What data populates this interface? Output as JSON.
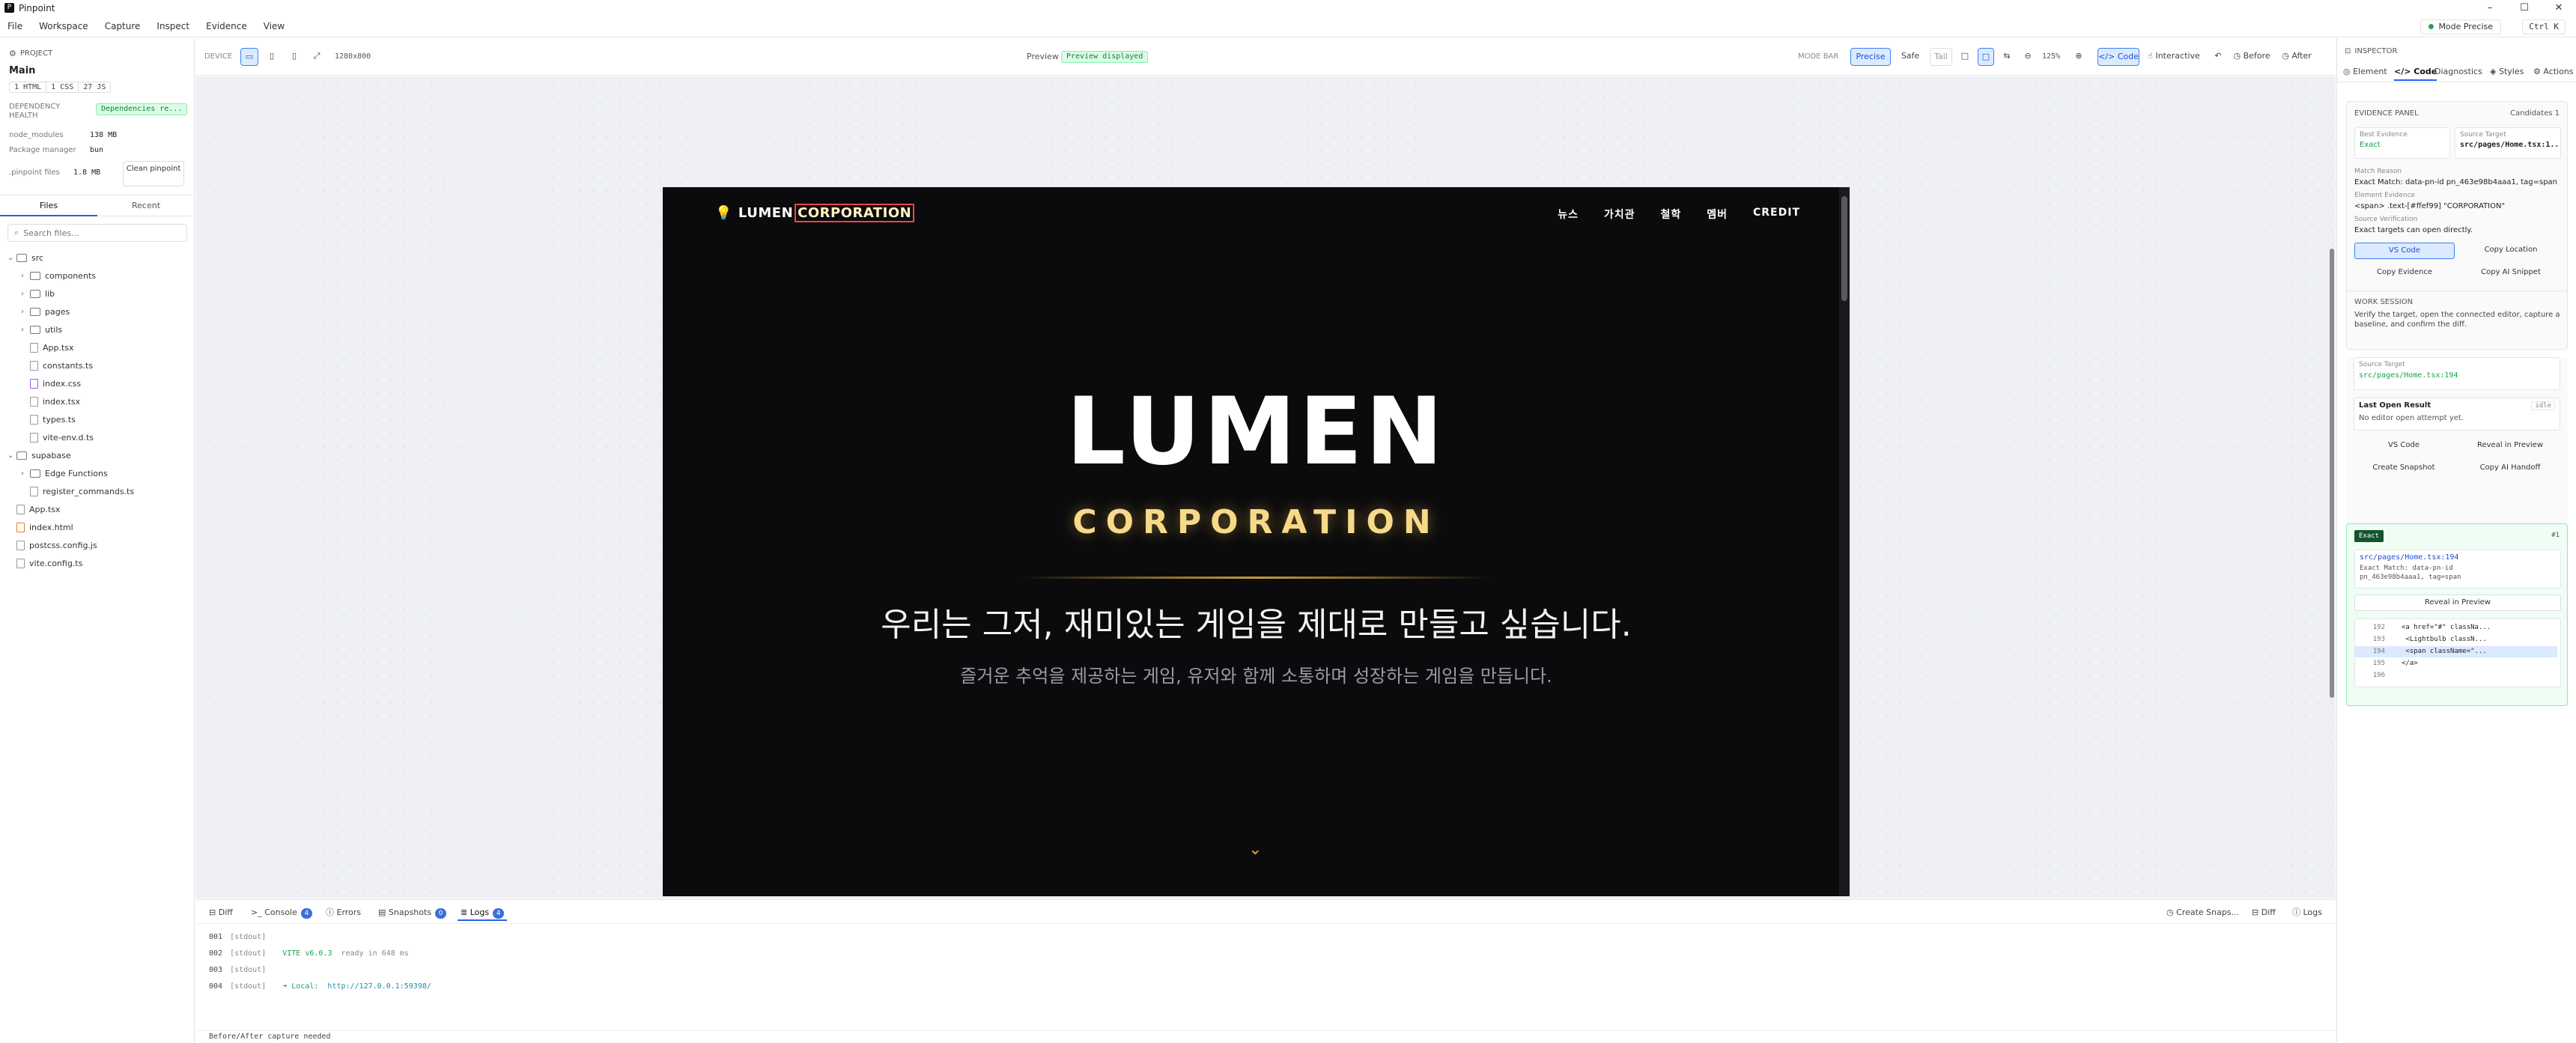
{
  "titlebar": {
    "app_name": "Pinpoint",
    "minimize": "–",
    "maximize": "☐",
    "close": "✕"
  },
  "menu": {
    "items": [
      "File",
      "Workspace",
      "Capture",
      "Inspect",
      "Evidence",
      "View"
    ]
  },
  "mode_pill": {
    "label": "Mode Precise"
  },
  "shortcut": {
    "label": "Ctrl K"
  },
  "project": {
    "header": "PROJECT",
    "name": "Main",
    "chips": [
      "1 HTML",
      "1 CSS",
      "27 JS"
    ],
    "dependency_label": "DEPENDENCY HEALTH",
    "dependency_status": "Dependencies re...",
    "node_modules_label": "node_modules",
    "node_modules_value": "138 MB",
    "package_manager_label": "Package manager",
    "package_manager_value": "bun",
    "pinpoint_files_label": ".pinpoint files",
    "pinpoint_files_value": "1.8 MB",
    "clean_button": "Clean pinpoint"
  },
  "file_tabs": {
    "files": "Files",
    "recent": "Recent"
  },
  "search": {
    "placeholder": "Search files..."
  },
  "tree": [
    {
      "name": "src",
      "type": "folder",
      "level": 0,
      "open": true
    },
    {
      "name": "components",
      "type": "folder",
      "level": 1,
      "open": false
    },
    {
      "name": "lib",
      "type": "folder",
      "level": 1,
      "open": false
    },
    {
      "name": "pages",
      "type": "folder",
      "level": 1,
      "open": false
    },
    {
      "name": "utils",
      "type": "folder",
      "level": 1,
      "open": false
    },
    {
      "name": "App.tsx",
      "type": "file",
      "level": 1
    },
    {
      "name": "constants.ts",
      "type": "file",
      "level": 1
    },
    {
      "name": "index.css",
      "type": "css",
      "level": 1
    },
    {
      "name": "index.tsx",
      "type": "file",
      "level": 1
    },
    {
      "name": "types.ts",
      "type": "file",
      "level": 1
    },
    {
      "name": "vite-env.d.ts",
      "type": "file",
      "level": 1
    },
    {
      "name": "supabase",
      "type": "folder",
      "level": 0,
      "open": true
    },
    {
      "name": "Edge Functions",
      "type": "folder",
      "level": 1,
      "open": false
    },
    {
      "name": "register_commands.ts",
      "type": "file",
      "level": 1
    },
    {
      "name": "App.tsx",
      "type": "file",
      "level": 0
    },
    {
      "name": "index.html",
      "type": "html",
      "level": 0
    },
    {
      "name": "postcss.config.js",
      "type": "file",
      "level": 0
    },
    {
      "name": "vite.config.ts",
      "type": "file",
      "level": 0
    }
  ],
  "toolbar": {
    "device_label": "DEVICE",
    "resolution": "1280x800",
    "preview_label": "Preview",
    "preview_status": "Preview displayed",
    "mode_bar_label": "MODE BAR",
    "precise": "Precise",
    "safe": "Safe",
    "tail": "Tail",
    "zoom": "125%",
    "code": "Code",
    "interactive": "Interactive",
    "before": "Before",
    "after": "After"
  },
  "site": {
    "brand_a": "LUMEN",
    "brand_b": "CORPORATION",
    "nav": [
      "뉴스",
      "가치관",
      "철학",
      "멤버",
      "CREDIT"
    ],
    "hero_title": "LUMEN",
    "hero_subtitle": "CORPORATION",
    "tagline": "우리는 그저, 재미있는 게임을 제대로 만들고 싶습니다.",
    "subtagline": "즐거운 추억을 제공하는 게임, 유저와 함께 소통하며 성장하는 게임을 만듭니다.",
    "accent": "#f5c451"
  },
  "bottom_tabs": {
    "diff": "Diff",
    "console": "Console",
    "console_count": "4",
    "errors": "Errors",
    "snapshots": "Snapshots",
    "snapshots_count": "0",
    "logs": "Logs",
    "logs_count": "4",
    "create_snapshot": "Create Snaps...",
    "diff_right": "Diff",
    "logs_right": "Logs"
  },
  "logs": [
    {
      "num": "001",
      "src": "[stdout]",
      "msg": "",
      "extra": ""
    },
    {
      "num": "002",
      "src": "[stdout]",
      "msg": "VITE v6.0.3",
      "extra": "ready in 648 ms"
    },
    {
      "num": "003",
      "src": "[stdout]",
      "msg": "",
      "extra": ""
    },
    {
      "num": "004",
      "src": "[stdout]",
      "msg": "➜  Local:",
      "extra": "http://127.0.0.1:59398/"
    }
  ],
  "status": {
    "text": "Before/After capture needed"
  },
  "inspector": {
    "header": "INSPECTOR",
    "tabs": [
      "Element",
      "Code",
      "Diagnostics",
      "Styles",
      "Actions"
    ],
    "evidence_panel": "EVIDENCE PANEL",
    "candidates": "Candidates 1",
    "best_evidence_label": "Best Evidence",
    "best_evidence_value": "Exact",
    "source_target_label": "Source Target",
    "source_target_value": "src/pages/Home.tsx:1...",
    "match_reason_label": "Match Reason",
    "match_reason_value": "Exact Match: data-pn-id pn_463e98b4aaa1, tag=span",
    "element_evidence_label": "Element Evidence",
    "element_evidence_value": "<span> .text-[#ffef99] \"CORPORATION\"",
    "source_verification_label": "Source Verification",
    "source_verification_value": "Exact targets can open directly.",
    "btn_vscode": "VS Code",
    "btn_copy_location": "Copy Location",
    "btn_copy_evidence": "Copy Evidence",
    "btn_copy_ai": "Copy AI Snippet",
    "work_session": "WORK SESSION",
    "work_desc": "Verify the target, open the connected editor, capture a baseline, and confirm the diff.",
    "ws_source_target_label": "Source Target",
    "ws_source_target_value": "src/pages/Home.tsx:194",
    "last_open_label": "Last Open Result",
    "last_open_state": "idle",
    "last_open_value": "No editor open attempt yet.",
    "btn_ws_vscode": "VS Code",
    "btn_reveal": "Reveal in Preview",
    "btn_create_snapshot": "Create Snapshot",
    "btn_copy_handoff": "Copy AI Handoff",
    "candidate_badge": "Exact",
    "candidate_index": "#1",
    "candidate_path": "src/pages/Home.tsx:194",
    "candidate_reason": "Exact Match: data-pn-id pn_463e98b4aaa1, tag=span",
    "candidate_reveal": "Reveal in Preview",
    "code_lines": [
      {
        "n": "192",
        "code": "<a href=\"#\" classNa..."
      },
      {
        "n": "193",
        "code": "  <Lightbulb classN..."
      },
      {
        "n": "194",
        "code": "  <span className=\"..."
      },
      {
        "n": "195",
        "code": "</a>"
      },
      {
        "n": "196",
        "code": ""
      }
    ]
  }
}
